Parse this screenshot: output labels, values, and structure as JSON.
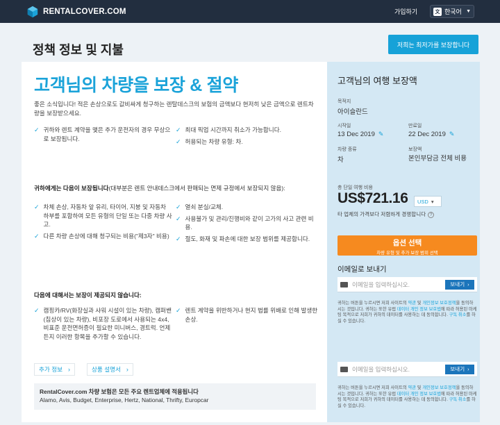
{
  "header": {
    "logo": "RENTALCOVER.COM",
    "login": "가입하기",
    "language": "한국어"
  },
  "page": {
    "title": "정책 정보 및 지불",
    "guarantee_button": "저희는 최저가를 보장합니다"
  },
  "left": {
    "headline": "고객님의 차량을 보장 & 절약",
    "intro": "좋은 소식입니다! 적은 손상으로도 값비싸게 청구하는 렌탈데스크의 보험의 금액보다 현저히 낮은 금액으로 렌트차량을 보장받으세요.",
    "benefits_left": [
      "귀하와 렌트 계약을 맺은 추가 운전자의 경우 무상으로 보장됩니다."
    ],
    "benefits_right": [
      "최대 픽업 시간까지 취소가 가능합니다.",
      "허용되는 차량 유형: 차."
    ],
    "covered_heading_bold": "귀하에게는 다음이 보장됩니다",
    "covered_heading_rest": "(대부분은 렌트 안내데스크에서 판매되는 면제 규정에서 보장되지 않음):",
    "covered_left": [
      "차체 손상, 자동차 앞 유리, 타이어, 지붕 및 자동차 하부를 포함하여 모든 유형의 단일 또는 다중 차량 사고.",
      "다른 차량 손상에 대해 청구되는 비용(\"제3자\" 비용)"
    ],
    "covered_right": [
      "열쇠 분실/교체.",
      "사용불가 및 관리/진행비와 같이 고가의 사고 관련 비용.",
      "절도, 화재 및 파손에 대한 보장 범위를 제공합니다."
    ],
    "not_covered_heading": "다음에 대해서는 보장이 제공되지 않습니다:",
    "not_covered_left": [
      "캠핑카/RV(화장실과 샤워 시설이 있는 차량), 캠퍼밴(침상이 있는 차량), 비포장 도로에서 사용되는 4x4, 비표준 운전면허증이 필요한 미니버스, 경트럭. 언제든지 이러한 항목을 추가할 수 있습니다."
    ],
    "not_covered_right": [
      "렌트 계약을 위반하거나 현지 법률 위배로 인해 발생한 손상."
    ],
    "chip_more": "추가 정보",
    "chip_product": "상품 설명서",
    "partners_title": "RentalCover.com 차량 보험은 모든 주요 렌트업체에 적용됩니다",
    "partners_list": "Alamo, Avis, Budget, Enterprise, Hertz, National, Thrifty, Europcar"
  },
  "right": {
    "title": "고객님의 여행 보장액",
    "destination_label": "목적지",
    "destination": "아이슬란드",
    "start_label": "시작일",
    "start": "13 Dec 2019",
    "end_label": "만료일",
    "end": "22 Dec 2019",
    "vehicle_label": "차량 종류",
    "vehicle": "차",
    "coverage_label": "보장액",
    "coverage": "본인부담금 전체 비용",
    "total_label": "총 단일 여행 비용",
    "price": "US$721.16",
    "currency": "USD",
    "compare": "타 업체의 가격보다 저렴하게 경쟁합니다",
    "option_main": "옵션 선택",
    "option_sub": "차량 유형 및 추가 보장 범위 선택",
    "email_title": "이메일로 보내기",
    "email_placeholder": "이메일을 입력하십시오.",
    "send": "보내기",
    "consent_a": "귀하는 버튼을 누르시면 저희 사이트의 ",
    "terms": "약관",
    "and": " 및 ",
    "privacy": "개인정보 보호정책",
    "consent_b": "을 동의하시는 것입니다. 귀하는 또한 유럽 ",
    "gdpr": "데이터 개인 정보 보호법",
    "consent_c": "에 따라 허용된 마케팅 목적으로 저희가 귀하의 데이터를 사용하는 데 동의합니다. ",
    "unsubscribe": "구독 취소",
    "consent_d": "를 하실 수 있습니다."
  }
}
